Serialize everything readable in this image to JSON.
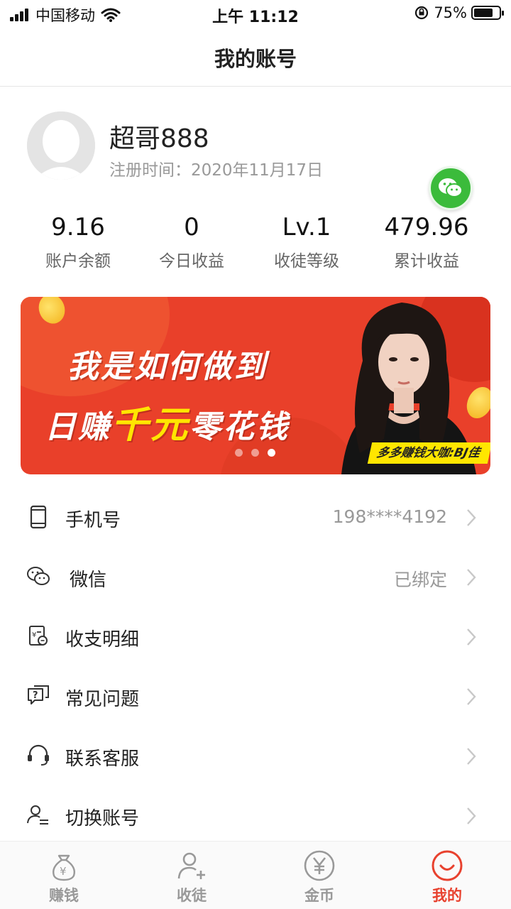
{
  "status_bar": {
    "carrier": "中国移动",
    "time": "上午 11:12",
    "battery": "75%",
    "battery_level": 0.75
  },
  "nav": {
    "title": "我的账号"
  },
  "profile": {
    "username": "超哥888",
    "register_time": "注册时间：2020年11月17日",
    "badge_icon": "wechat-icon"
  },
  "stats": [
    {
      "value": "9.16",
      "label": "账户余额"
    },
    {
      "value": "0",
      "label": "今日收益"
    },
    {
      "value": "Lv.1",
      "label": "收徒等级"
    },
    {
      "value": "479.96",
      "label": "累计收益"
    }
  ],
  "banner": {
    "line1": "我是如何做到",
    "line2_prefix": "日赚",
    "line2_highlight": "千元",
    "line2_suffix": "零花钱",
    "tag": "多多赚钱大咖:BJ佳",
    "slides": 3,
    "active_slide": 3
  },
  "menu": [
    {
      "label": "手机号",
      "value": "198****4192",
      "icon": "phone-icon"
    },
    {
      "label": "微信",
      "value": "已绑定",
      "icon": "wechat-icon"
    },
    {
      "label": "收支明细",
      "value": "",
      "icon": "ledger-icon"
    },
    {
      "label": "常见问题",
      "value": "",
      "icon": "faq-icon"
    },
    {
      "label": "联系客服",
      "value": "",
      "icon": "headset-icon"
    },
    {
      "label": "切换账号",
      "value": "",
      "icon": "switch-account-icon"
    }
  ],
  "tabbar": [
    {
      "label": "赚钱",
      "icon": "money-bag-icon",
      "active": false
    },
    {
      "label": "收徒",
      "icon": "add-user-icon",
      "active": false
    },
    {
      "label": "金币",
      "icon": "coin-icon",
      "active": false
    },
    {
      "label": "我的",
      "icon": "smile-icon",
      "active": true
    }
  ],
  "colors": {
    "accent": "#e8412e",
    "banner_bg": "#e9402a",
    "highlight_yellow": "#ffe600",
    "wechat_green": "#3bbb3b"
  }
}
